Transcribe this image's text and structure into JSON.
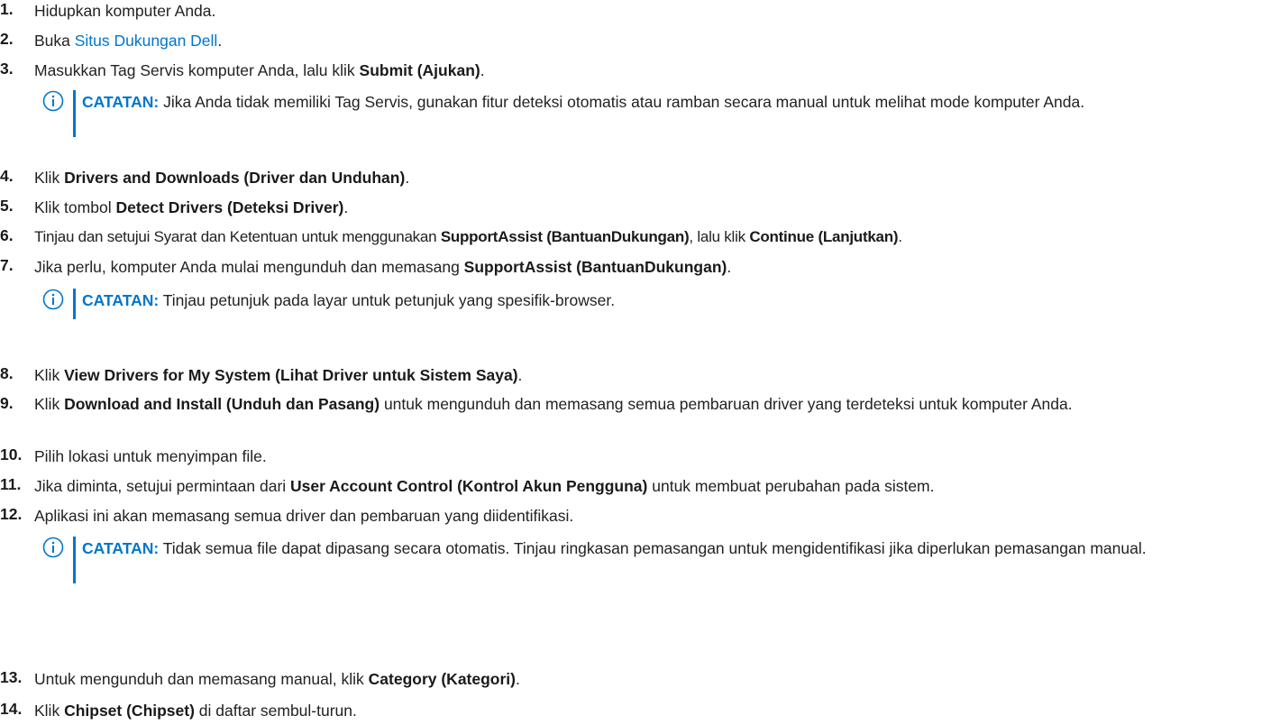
{
  "colors": {
    "link": "#0076ce",
    "note_accent": "#0076ce",
    "text": "#222222"
  },
  "steps": [
    {
      "num": "1.",
      "text": "Hidupkan komputer Anda."
    },
    {
      "num": "2.",
      "pre": "Buka ",
      "link": "Situs Dukungan Dell",
      "post": "."
    },
    {
      "num": "3.",
      "pre": "Masukkan Tag Servis komputer Anda, lalu klik ",
      "bold": "Submit (Ajukan)",
      "post": "."
    },
    {
      "num": "4.",
      "pre": "Klik ",
      "bold": "Drivers and Downloads (Driver dan Unduhan)",
      "post": "."
    },
    {
      "num": "5.",
      "pre": "Klik tombol ",
      "bold": "Detect Drivers (Deteksi Driver)",
      "post": "."
    },
    {
      "num": "6.",
      "pre": "Tinjau dan setujui Syarat dan Ketentuan untuk menggunakan ",
      "bold": "SupportAssist (BantuanDukungan)",
      "mid": ", lalu klik ",
      "bold2": "Continue (Lanjutkan)",
      "post": "."
    },
    {
      "num": "7.",
      "pre": "Jika perlu, komputer Anda mulai mengunduh dan memasang ",
      "bold": "SupportAssist (BantuanDukungan)",
      "post": "."
    },
    {
      "num": "8.",
      "pre": "Klik ",
      "bold": "View Drivers for My System (Lihat Driver untuk Sistem Saya)",
      "post": "."
    },
    {
      "num": "9.",
      "pre": "Klik ",
      "bold": "Download and Install (Unduh dan Pasang)",
      "post": " untuk mengunduh dan memasang semua pembaruan driver yang terdeteksi untuk komputer Anda."
    },
    {
      "num": "10.",
      "text": "Pilih lokasi untuk menyimpan file."
    },
    {
      "num": "11.",
      "pre": "Jika diminta, setujui permintaan dari ",
      "bold": "User Account Control (Kontrol Akun Pengguna)",
      "post": " untuk membuat perubahan pada sistem."
    },
    {
      "num": "12.",
      "text": "Aplikasi ini akan memasang semua driver dan pembaruan yang diidentifikasi."
    },
    {
      "num": "13.",
      "pre": "Untuk mengunduh dan memasang manual, klik ",
      "bold": "Category (Kategori)",
      "post": "."
    },
    {
      "num": "14.",
      "pre": "Klik ",
      "bold": "Chipset (Chipset)",
      "post": " di daftar sembul-turun."
    }
  ],
  "notes": [
    {
      "label": "CATATAN:",
      "text": " Jika Anda tidak memiliki Tag Servis, gunakan fitur deteksi otomatis atau ramban secara manual untuk melihat mode komputer Anda."
    },
    {
      "label": "CATATAN:",
      "text": " Tinjau petunjuk pada layar untuk petunjuk yang spesifik-browser."
    },
    {
      "label": "CATATAN:",
      "text": " Tidak semua file dapat dipasang secara otomatis. Tinjau ringkasan pemasangan untuk mengidentifikasi jika diperlukan pemasangan manual."
    }
  ],
  "icons": {
    "note": "info-circle-icon"
  }
}
